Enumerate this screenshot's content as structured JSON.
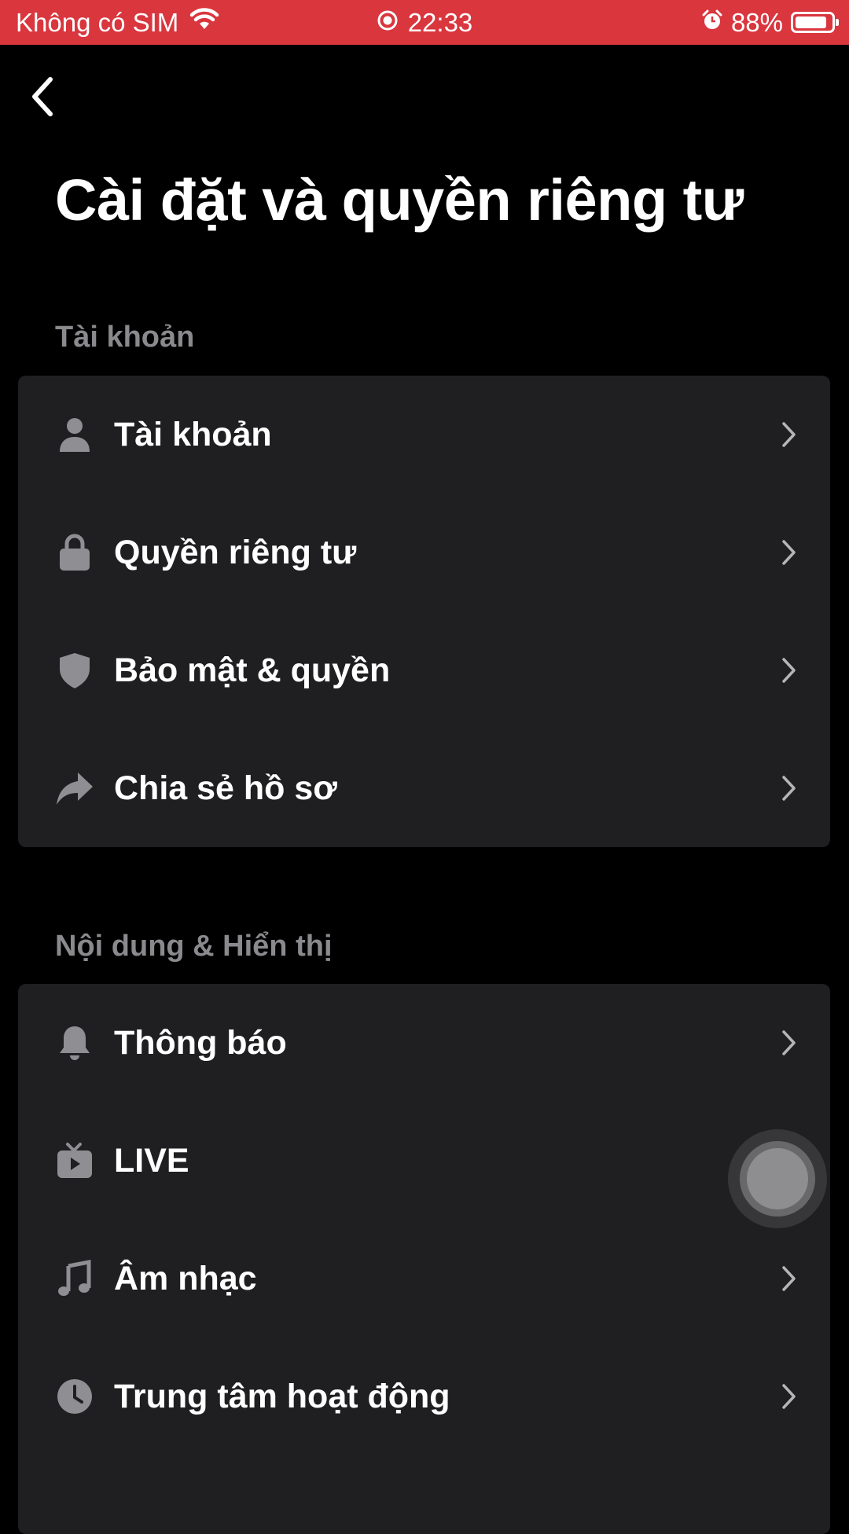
{
  "status_bar": {
    "carrier": "Không có SIM",
    "time": "22:33",
    "battery": "88%",
    "battery_level": 0.88,
    "background": "#d9363e"
  },
  "header": {
    "back_icon": "chevron-left-icon",
    "title": "Cài đặt và quyền riêng tư"
  },
  "sections": [
    {
      "label": "Tài khoản",
      "items": [
        {
          "label": "Tài khoản",
          "icon": "person-icon"
        },
        {
          "label": "Quyền riêng tư",
          "icon": "lock-icon"
        },
        {
          "label": "Bảo mật & quyền",
          "icon": "shield-icon"
        },
        {
          "label": "Chia sẻ hồ sơ",
          "icon": "share-icon"
        }
      ]
    },
    {
      "label": "Nội dung & Hiển thị",
      "items": [
        {
          "label": "Thông báo",
          "icon": "bell-icon"
        },
        {
          "label": "LIVE",
          "icon": "tv-icon"
        },
        {
          "label": "Âm nhạc",
          "icon": "music-note-icon"
        },
        {
          "label": "Trung tâm hoạt động",
          "icon": "clock-icon"
        }
      ]
    }
  ],
  "colors": {
    "background": "#000000",
    "card": "#1f1f21",
    "section_label": "#8a8a8e",
    "icon": "#8e8e93",
    "chevron": "#b5b5b8"
  }
}
